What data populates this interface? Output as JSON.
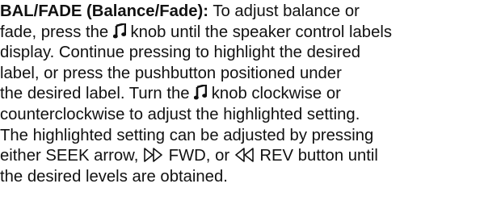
{
  "paragraph": {
    "term": "BAL/FADE (Balance/Fade):",
    "l1": " To adjust balance or",
    "l2a": "fade, press the ",
    "l2b": " knob until the speaker control labels",
    "l3": "display. Continue pressing to highlight the desired",
    "l4": "label, or press the pushbutton positioned under",
    "l5a": "the desired label. Turn the ",
    "l5b": " knob clockwise or",
    "l6": "counterclockwise to adjust the highlighted setting.",
    "l7": "The highlighted setting can be adjusted by pressing",
    "l8a": "either SEEK arrow, ",
    "l8b": " FWD, or ",
    "l8c": " REV button until",
    "l9": "the desired levels are obtained."
  },
  "icons": {
    "music_note": "music-note-icon",
    "forward": "double-triangle-right-icon",
    "reverse": "double-triangle-left-icon"
  }
}
